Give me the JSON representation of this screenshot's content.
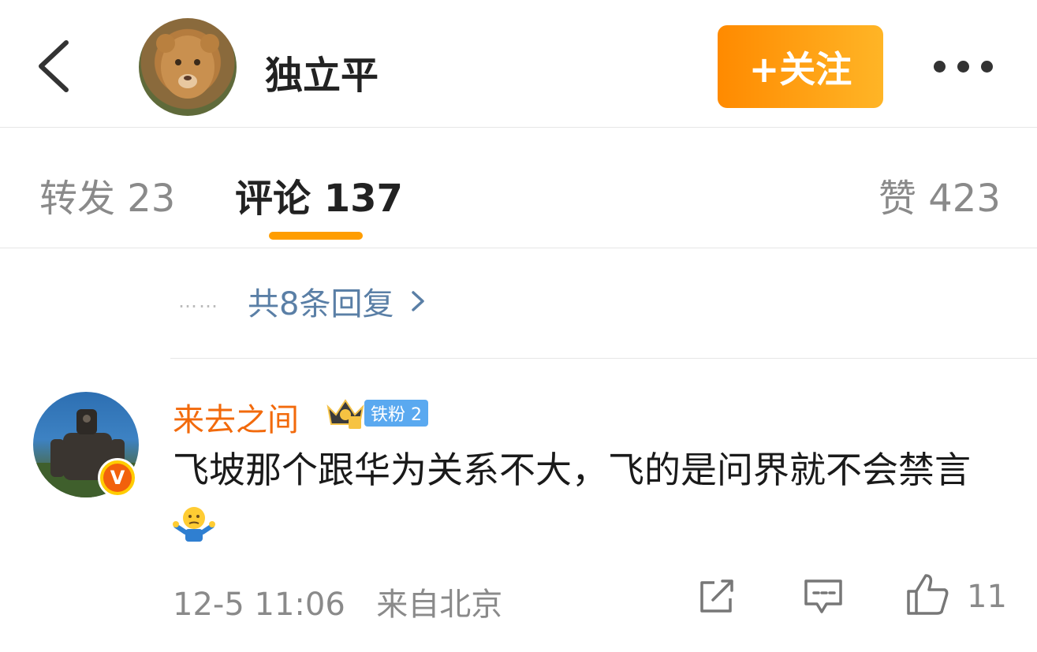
{
  "header": {
    "back_icon": "chevron-left-icon",
    "username": "独立平",
    "follow_label": "+关注",
    "more_icon": "more-horizontal-icon",
    "accent": "#ff9500"
  },
  "tabs": [
    {
      "label": "转发 23",
      "active": false
    },
    {
      "label": "评论 137",
      "active": true
    },
    {
      "label": "赞 423",
      "active": false
    }
  ],
  "replies": {
    "dots": "……",
    "label": "共8条回复"
  },
  "comment": {
    "author": "来去之间",
    "fan_badge": "铁粉 2",
    "text": "飞坡那个跟华为关系不大，飞的是问界就不会禁言",
    "time": "12-5 11:06",
    "location": "来自北京",
    "likes": "11",
    "author_color": "#f26a0c"
  }
}
